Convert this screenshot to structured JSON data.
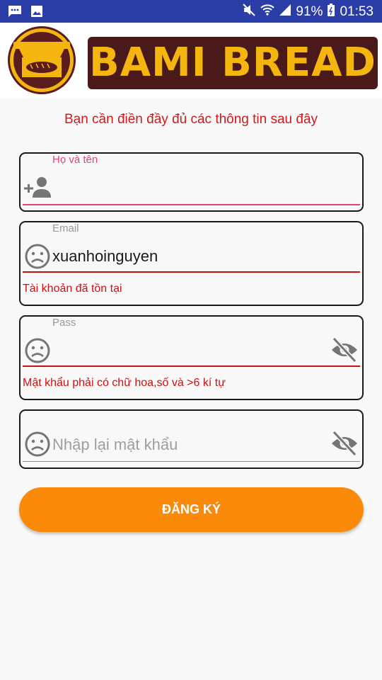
{
  "status_bar": {
    "battery": "91%",
    "time": "01:53",
    "icons": [
      "message-icon",
      "image-icon",
      "mute-icon",
      "wifi-icon",
      "signal-icon",
      "battery-icon"
    ]
  },
  "brand": {
    "logo_icon": "bread-shop-icon",
    "text": "BAMI BREAD",
    "colors": {
      "primary": "#f5b50f",
      "secondary": "#4a1a1a"
    }
  },
  "form": {
    "notice": "Bạn cần điền đầy đủ các thông tin sau đây",
    "fullname": {
      "label": "Họ và tên",
      "value": "",
      "icon": "add-person-icon"
    },
    "email": {
      "label": "Email",
      "value": "xuanhoinguyen",
      "error": "Tài khoản đã tồn tại",
      "icon": "sad-face-icon"
    },
    "password": {
      "label": "Pass",
      "value": "",
      "error": "Mật khẩu phải có chữ hoa,số và >6 kí tự",
      "icon": "sad-face-icon",
      "toggle_icon": "eye-off-icon"
    },
    "confirm": {
      "placeholder": "Nhập lại mật khẩu",
      "value": "",
      "icon": "sad-face-icon",
      "toggle_icon": "eye-off-icon"
    },
    "submit_label": "ĐĂNG KÝ"
  },
  "colors": {
    "status_bar": "#2b3ea8",
    "accent": "#fb8a09",
    "error": "#cc1111",
    "focus": "#e2437a"
  }
}
